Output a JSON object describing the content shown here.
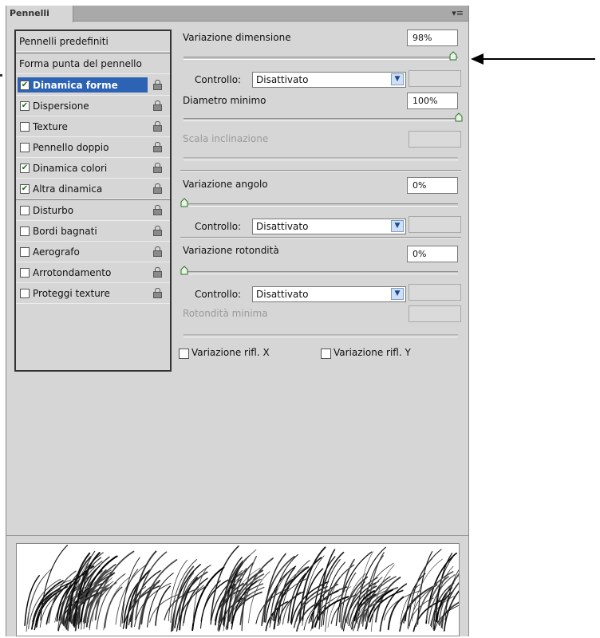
{
  "panel": {
    "tab_title": "Pennelli",
    "menu_icon": "panel-menu-icon"
  },
  "sidebar": {
    "items": [
      {
        "label": "Pennelli predefiniti",
        "checkbox": false,
        "lock": false,
        "checked": false
      },
      {
        "label": "Forma punta del pennello",
        "checkbox": false,
        "lock": false,
        "checked": false
      },
      {
        "label": "Dinamica forme",
        "checkbox": true,
        "lock": true,
        "checked": true,
        "selected": true
      },
      {
        "label": "Dispersione",
        "checkbox": true,
        "lock": true,
        "checked": true
      },
      {
        "label": "Texture",
        "checkbox": true,
        "lock": true,
        "checked": false
      },
      {
        "label": "Pennello doppio",
        "checkbox": true,
        "lock": true,
        "checked": false
      },
      {
        "label": "Dinamica colori",
        "checkbox": true,
        "lock": true,
        "checked": true
      },
      {
        "label": "Altra dinamica",
        "checkbox": true,
        "lock": true,
        "checked": true
      },
      {
        "label": "Disturbo",
        "checkbox": true,
        "lock": true,
        "checked": false
      },
      {
        "label": "Bordi bagnati",
        "checkbox": true,
        "lock": true,
        "checked": false
      },
      {
        "label": "Aerografo",
        "checkbox": true,
        "lock": true,
        "checked": false
      },
      {
        "label": "Arrotondamento",
        "checkbox": true,
        "lock": true,
        "checked": false
      },
      {
        "label": "Proteggi texture",
        "checkbox": true,
        "lock": true,
        "checked": false
      }
    ]
  },
  "settings": {
    "size_jitter": {
      "label": "Variazione dimensione",
      "value": "98%",
      "slider": 0.98
    },
    "size_control": {
      "label": "Controllo:",
      "value": "Disattivato"
    },
    "min_diameter": {
      "label": "Diametro minimo",
      "value": "100%",
      "slider": 1.0
    },
    "tilt_scale": {
      "label": "Scala inclinazione",
      "value": ""
    },
    "angle_jitter": {
      "label": "Variazione angolo",
      "value": "0%",
      "slider": 0.0
    },
    "angle_control": {
      "label": "Controllo:",
      "value": "Disattivato"
    },
    "roundness_jitter": {
      "label": "Variazione rotondità",
      "value": "0%",
      "slider": 0.0
    },
    "roundness_control": {
      "label": "Controllo:",
      "value": "Disattivato"
    },
    "min_roundness": {
      "label": "Rotondità minima",
      "value": ""
    },
    "flip_x": {
      "label": "Variazione rifl. X",
      "checked": false
    },
    "flip_y": {
      "label": "Variazione rifl. Y",
      "checked": false
    }
  },
  "colors": {
    "panel_bg": "#d6d6d6",
    "selection": "#2d63b5",
    "checkmark": "#1c6e1c"
  }
}
